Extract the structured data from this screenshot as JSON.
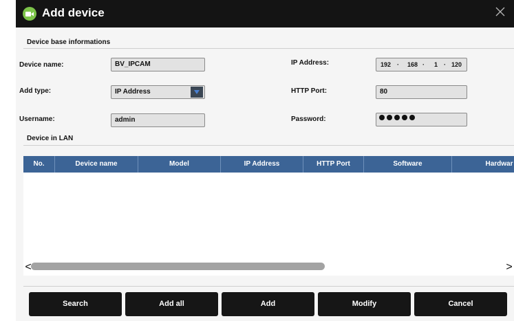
{
  "window": {
    "title": "Add device",
    "title_icon": "camera-icon",
    "close_icon": "close-icon"
  },
  "base_section": {
    "label": "Device base informations"
  },
  "form": {
    "device_name": {
      "label": "Device name:",
      "value": "BV_IPCAM"
    },
    "add_type": {
      "label": "Add type:",
      "value": "IP Address"
    },
    "username": {
      "label": "Username:",
      "value": "admin"
    },
    "ip_address": {
      "label": "IP Address:",
      "octets": [
        "192",
        "168",
        "1",
        "120"
      ],
      "separator": "·"
    },
    "http_port": {
      "label": "HTTP Port:",
      "value": "80"
    },
    "password": {
      "label": "Password:",
      "masked_length": 5
    }
  },
  "lan_section": {
    "label": "Device in LAN"
  },
  "table": {
    "columns": [
      "No.",
      "Device name",
      "Model",
      "IP Address",
      "HTTP Port",
      "Software",
      "Hardwar"
    ],
    "rows": []
  },
  "scrollbar": {
    "left": "<",
    "right": ">",
    "thumb_fraction": 0.6
  },
  "buttons": {
    "search": "Search",
    "add_all": "Add all",
    "add": "Add",
    "modify": "Modify",
    "cancel": "Cancel"
  },
  "colors": {
    "titlebar": "#141414",
    "accent_green": "#7dc44a",
    "table_header": "#3c6496",
    "button": "#161616"
  }
}
